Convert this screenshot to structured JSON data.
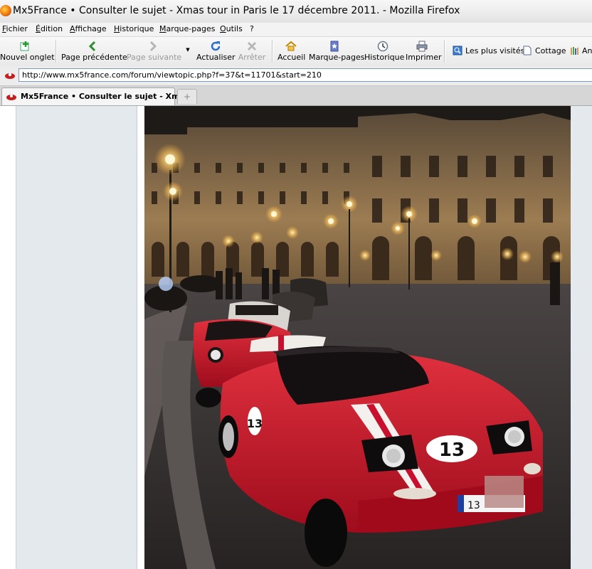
{
  "window": {
    "title": "Mx5France • Consulter le sujet - Xmas tour in Paris le 17 décembre 2011. - Mozilla Firefox"
  },
  "menu": [
    "Fichier",
    "Édition",
    "Affichage",
    "Historique",
    "Marque-pages",
    "Outils",
    "?"
  ],
  "toolbar": {
    "new_tab": "Nouvel onglet",
    "back": "Page précédente",
    "forward": "Page suivante",
    "reload": "Actualiser",
    "stop": "Arrêter",
    "home": "Accueil",
    "bookmarks": "Marque-pages",
    "history": "Historique",
    "print": "Imprimer"
  },
  "bookmarks_bar": {
    "most_visited": "Les plus visités",
    "cottage": "Cottage",
    "partial": "An"
  },
  "url": {
    "value": "http://www.mx5france.com/forum/viewtopic.php?f=37&t=11701&start=210"
  },
  "tabs": {
    "active_label": "Mx5France • Consulter le sujet - Xm...",
    "new_tab_symbol": "+"
  },
  "photo": {
    "car_number": "13",
    "plate_prefix": "13"
  },
  "colors": {
    "car_red": "#c8102e",
    "sidebar": "#e4e9ed",
    "lamp": "#ffd27a"
  }
}
